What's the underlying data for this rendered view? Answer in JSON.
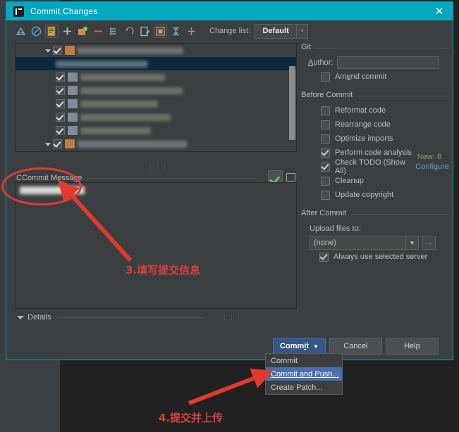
{
  "window": {
    "title": "Commit Changes",
    "app_icon": "intellij-idea-icon",
    "close_label": "✕"
  },
  "toolbar": {
    "icons": [
      {
        "name": "show-diff-icon",
        "color": "#6ea8d8"
      },
      {
        "name": "revert-icon",
        "color": "#4f9fd4"
      },
      {
        "name": "edit-changelist-icon",
        "color": "#c8a15a"
      },
      {
        "name": "add-changelist-icon",
        "color": "#90c272"
      },
      {
        "name": "move-to-changelist-icon",
        "color": "#cf8e3e"
      },
      {
        "name": "delete-icon",
        "color": "#d0634f"
      },
      {
        "name": "group-by-icon",
        "color": "#8ba3b8"
      },
      {
        "name": "rollback-icon",
        "color": "#b064b0"
      },
      {
        "name": "show-diff-editor-icon",
        "color": "#7fbf5f"
      },
      {
        "name": "preview-diff-icon",
        "color": "#c8a15a"
      },
      {
        "name": "collapse-all-icon",
        "color": "#6ea8d8"
      },
      {
        "name": "expand-all-icon",
        "color": "#9aa0a6"
      }
    ],
    "changelist_label": "Change list:",
    "changelist_value": "Default"
  },
  "file_tree": {
    "rows": [
      {
        "indent": 1,
        "twisty": true,
        "checked": true,
        "icon": "folder",
        "blur_width": 150,
        "selected": false
      },
      {
        "indent": 2,
        "twisty": false,
        "checked": false,
        "icon": "none",
        "blur_width": 130,
        "selected": true
      },
      {
        "indent": 2,
        "twisty": false,
        "checked": true,
        "icon": "file",
        "blur_width": 120,
        "selected": false
      },
      {
        "indent": 2,
        "twisty": false,
        "checked": true,
        "icon": "file",
        "blur_width": 145,
        "selected": false
      },
      {
        "indent": 2,
        "twisty": false,
        "checked": true,
        "icon": "file",
        "blur_width": 110,
        "selected": false
      },
      {
        "indent": 2,
        "twisty": false,
        "checked": true,
        "icon": "file",
        "blur_width": 128,
        "selected": false
      },
      {
        "indent": 2,
        "twisty": false,
        "checked": true,
        "icon": "file",
        "blur_width": 100,
        "selected": false
      },
      {
        "indent": 1,
        "twisty": true,
        "checked": true,
        "icon": "folder",
        "blur_width": 155,
        "selected": false
      },
      {
        "indent": 2,
        "twisty": false,
        "checked": true,
        "icon": "file",
        "blur_width": 118,
        "selected": false
      }
    ],
    "new_count_label": "New: 8"
  },
  "commit_message": {
    "label": "Commit Message",
    "value_redacted": true,
    "spellcheck_icon": "spellcheck-icon",
    "history_icon": "message-history-icon"
  },
  "details": {
    "label": "Details",
    "expanded": false
  },
  "git_group": {
    "title": "Git",
    "author_label": "Author:",
    "author_value": "",
    "author_placeholder": "",
    "amend_label": "Amend commit",
    "amend_checked": false
  },
  "before_commit": {
    "title": "Before Commit",
    "items": [
      {
        "label": "Reformat code",
        "checked": false
      },
      {
        "label": "Rearrange code",
        "checked": false
      },
      {
        "label": "Optimize imports",
        "checked": false
      },
      {
        "label": "Perform code analysis",
        "checked": true
      },
      {
        "label": "Check TODO (Show All)",
        "checked": true,
        "link": "Configure"
      },
      {
        "label": "Cleanup",
        "checked": false
      },
      {
        "label": "Update copyright",
        "checked": false
      }
    ]
  },
  "after_commit": {
    "title": "After Commit",
    "upload_label": "Upload files to:",
    "upload_value": "(none)",
    "browse_label": "...",
    "always_use_label": "Always use selected server",
    "always_use_checked": true
  },
  "buttons": {
    "commit": "Commit",
    "commit_caret": "▾",
    "cancel": "Cancel",
    "help": "Help"
  },
  "popup_menu": {
    "items": [
      {
        "label": "Commit",
        "highlighted": false
      },
      {
        "label": "Commit and Push...",
        "highlighted": true
      },
      {
        "label": "Create Patch...",
        "highlighted": false
      }
    ]
  },
  "annotations": {
    "step3": "3.填写提交信息",
    "step4": "4.提交并上传",
    "color": "#d43f3a"
  },
  "colors": {
    "titlebar": "#03a9c0",
    "dialog_bg": "#3c3f41",
    "selection": "#0d293e",
    "primary_button": "#365880",
    "menu_highlight": "#4b6eaf",
    "link": "#5b9bd5",
    "new_count": "#8d9a5b",
    "annotation_red": "#d43f3a"
  }
}
